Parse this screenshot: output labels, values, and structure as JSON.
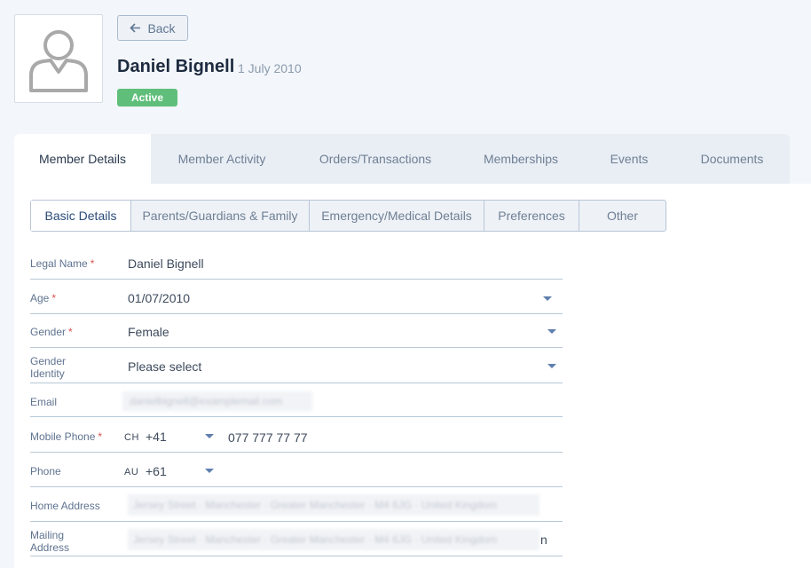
{
  "header": {
    "back_label": "Back",
    "member_name": "Daniel Bignell",
    "dob": "1 July 2010",
    "status": "Active"
  },
  "tabs": [
    "Member Details",
    "Member Activity",
    "Orders/Transactions",
    "Memberships",
    "Events",
    "Documents"
  ],
  "subtabs": [
    "Basic Details",
    "Parents/Guardians & Family",
    "Emergency/Medical Details",
    "Preferences",
    "Other"
  ],
  "form": {
    "legal_name": {
      "label": "Legal Name",
      "value": "Daniel Bignell"
    },
    "age": {
      "label": "Age",
      "value": "01/07/2010"
    },
    "gender": {
      "label": "Gender",
      "value": "Female"
    },
    "gender_identity": {
      "label": "Gender\nIdentity",
      "value": "Please select"
    },
    "email": {
      "label": "Email",
      "value": "danielbignell@examplemail.com"
    },
    "mobile_phone": {
      "label": "Mobile Phone",
      "country": "CH",
      "dial": "+41",
      "number": "077 777 77 77"
    },
    "phone": {
      "label": "Phone",
      "country": "AU",
      "dial": "+61"
    },
    "home_address": {
      "label": "Home Address",
      "value": "Jersey Street · Manchester · Greater Manchester · M4 6JG · United Kingdom"
    },
    "mailing_address": {
      "label": "Mailing\nAddress",
      "value": "Jersey Street · Manchester · Greater Manchester · M4 6JG · United Kingdom",
      "visible_tail": "n"
    }
  },
  "colors": {
    "accent": "#2b4b7a",
    "active_badge": "#5fbf7a",
    "required": "#d9534f"
  }
}
